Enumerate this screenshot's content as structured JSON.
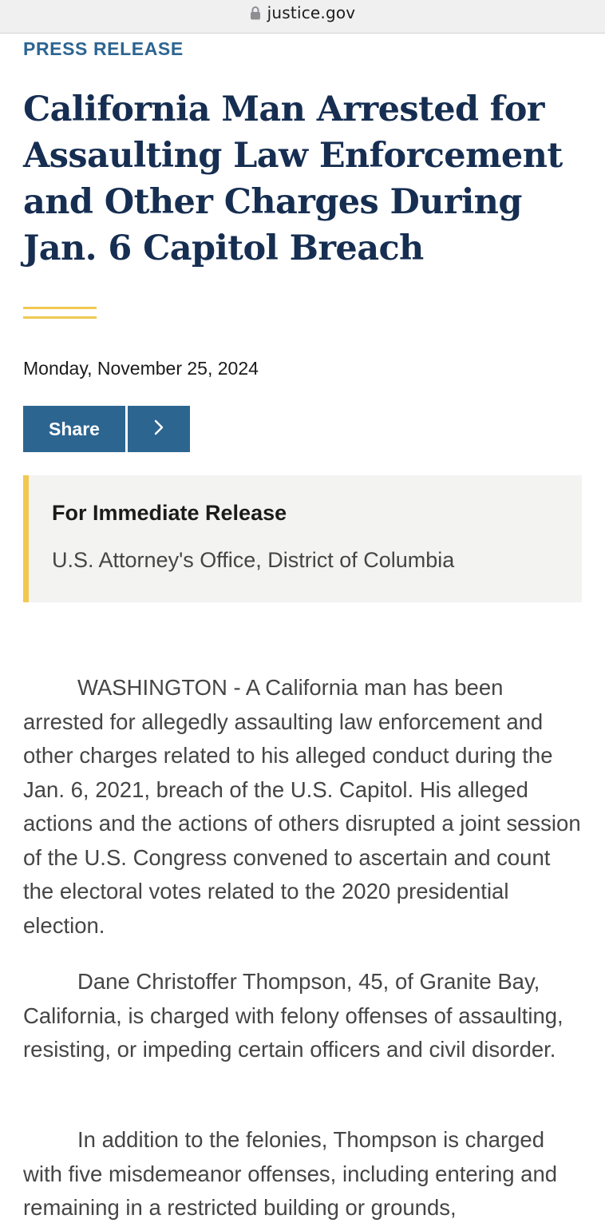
{
  "browser": {
    "url": "justice.gov",
    "lock_icon": "lock-icon"
  },
  "article": {
    "eyebrow": "PRESS RELEASE",
    "title": "California Man Arrested for Assaulting Law Enforcement and Other Charges During Jan. 6 Capitol Breach",
    "date": "Monday, November 25, 2024",
    "share_label": "Share",
    "share_icon": "chevron-right-icon",
    "release": {
      "heading": "For Immediate Release",
      "office": "U.S. Attorney's Office, District of Columbia"
    },
    "paragraphs": [
      "WASHINGTON - A California man has been arrested for allegedly assaulting law enforcement and other charges related to his alleged conduct during the Jan. 6, 2021, breach of the U.S. Capitol. His alleged actions and the actions of others disrupted a joint session of the U.S. Congress convened to ascertain and count the electoral votes related to the 2020 presidential election.",
      "Dane Christoffer Thompson, 45, of Granite Bay, California, is charged with felony offenses of assaulting, resisting, or impeding certain officers and civil disorder.",
      "In addition to the felonies, Thompson is charged with five misdemeanor offenses, including entering and remaining in a restricted building or grounds,"
    ]
  },
  "colors": {
    "accent_blue": "#2d6591",
    "headline_navy": "#162e51",
    "gold": "#f1c851",
    "box_bg": "#f3f3f1"
  }
}
